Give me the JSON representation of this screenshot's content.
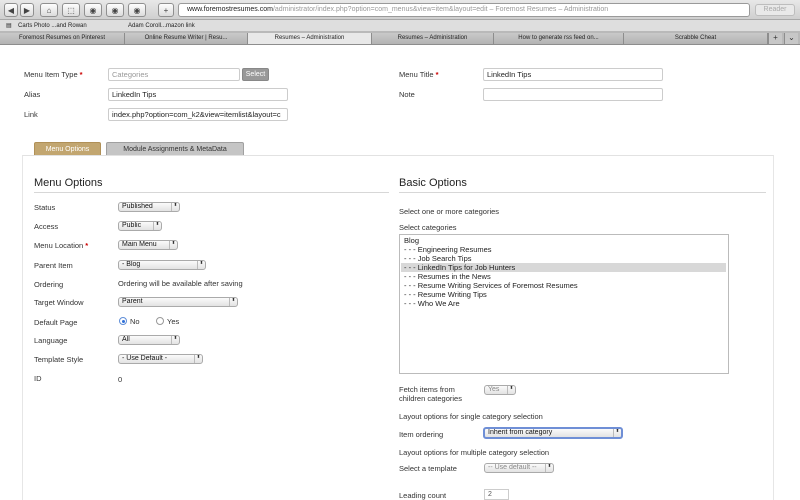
{
  "browser": {
    "nav": {
      "back": "◀",
      "forward": "▶",
      "home": "⌂",
      "share": "⬚",
      "history": "◉",
      "reload": "↻",
      "add": "+"
    },
    "url_host": "www.foremostresumes.com",
    "url_path": "/administrator/index.php?option=com_menus&view=item&layout=edit – Foremost Resumes – Administration",
    "reader": "Reader",
    "bookmarks": [
      "Carts Photo ...and Rowan",
      "Adam Coroll...mazon link"
    ],
    "tabs": [
      "Foremost Resumes on Pinterest",
      "Online Resume Writer | Resu...",
      "Resumes – Administration",
      "Resumes – Administration",
      "How to generate rss feed on...",
      "Scrabble Cheat"
    ],
    "new_tab": "+"
  },
  "form": {
    "menu_item_type": {
      "label": "Menu Item Type",
      "placeholder": "Categories",
      "button": "Select"
    },
    "alias": {
      "label": "Alias",
      "value": "LinkedIn Tips"
    },
    "link": {
      "label": "Link",
      "value": "index.php?option=com_k2&view=itemlist&layout=c"
    },
    "menu_title": {
      "label": "Menu Title",
      "value": "LinkedIn Tips"
    },
    "note": {
      "label": "Note",
      "value": ""
    },
    "required_mark": "*"
  },
  "form_tabs": {
    "menu_options": "Menu Options",
    "module_assignments": "Module Assignments & MetaData"
  },
  "menu_options": {
    "title": "Menu Options",
    "status": {
      "label": "Status",
      "value": "Published"
    },
    "access": {
      "label": "Access",
      "value": "Public"
    },
    "menu_location": {
      "label": "Menu Location",
      "value": "Main Menu"
    },
    "parent_item": {
      "label": "Parent Item",
      "value": "- Blog"
    },
    "ordering": {
      "label": "Ordering",
      "value": "Ordering will be available after saving"
    },
    "target_window": {
      "label": "Target Window",
      "value": "Parent"
    },
    "default_page": {
      "label": "Default Page",
      "no": "No",
      "yes": "Yes",
      "selected": "No"
    },
    "language": {
      "label": "Language",
      "value": "All"
    },
    "template_style": {
      "label": "Template Style",
      "value": "- Use Default -"
    },
    "id": {
      "label": "ID",
      "value": "0"
    }
  },
  "basic_options": {
    "title": "Basic Options",
    "intro": "Select one or more categories",
    "categories_label": "Select categories",
    "categories": [
      "Blog",
      "- - - Engineering Resumes",
      "- - - Job Search Tips",
      "- - - LinkedIn Tips for Job Hunters",
      "- - - Resumes in the News",
      "- - - Resume Writing Services of Foremost Resumes",
      "- - - Resume Writing Tips",
      "- - - Who We Are"
    ],
    "selected_category": "- - - LinkedIn Tips for Job Hunters",
    "fetch_children": {
      "label_line1": "Fetch items from",
      "label_line2": "children categories",
      "value": "Yes"
    },
    "single_layout_heading": "Layout options for single category selection",
    "item_ordering": {
      "label": "Item ordering",
      "value": "Inherit from category"
    },
    "multiple_layout_heading": "Layout options for multiple category selection",
    "select_template": {
      "label": "Select a template",
      "value": "-- Use default --"
    },
    "leading_count": {
      "label": "Leading count",
      "value": "2"
    }
  },
  "icons": {
    "select_arrows": "⬍",
    "dropdown_arrow": "▼"
  },
  "colors": {
    "active_tab": "#c2a670",
    "required": "#cc0000",
    "radio": "#2f6fd8"
  }
}
